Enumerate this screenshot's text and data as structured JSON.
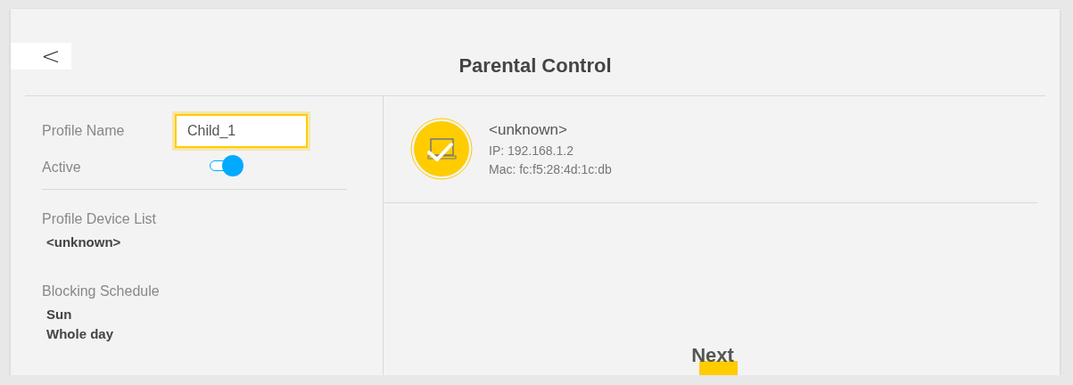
{
  "title": "Parental Control",
  "back_button": {
    "label": "<"
  },
  "profile_name": {
    "label": "Profile Name",
    "value": "Child_1"
  },
  "active": {
    "label": "Active",
    "on": true
  },
  "profile_device_list": {
    "label": "Profile Device List",
    "items": [
      "<unknown>"
    ]
  },
  "blocking_schedule": {
    "label": "Blocking Schedule",
    "items": [
      "Sun",
      "Whole day"
    ]
  },
  "devices": [
    {
      "name": "<unknown>",
      "ip": "IP: 192.168.1.2",
      "mac": "Mac: fc:f5:28:4d:1c:db",
      "selected": true
    }
  ],
  "next_button": {
    "label": "Next"
  }
}
